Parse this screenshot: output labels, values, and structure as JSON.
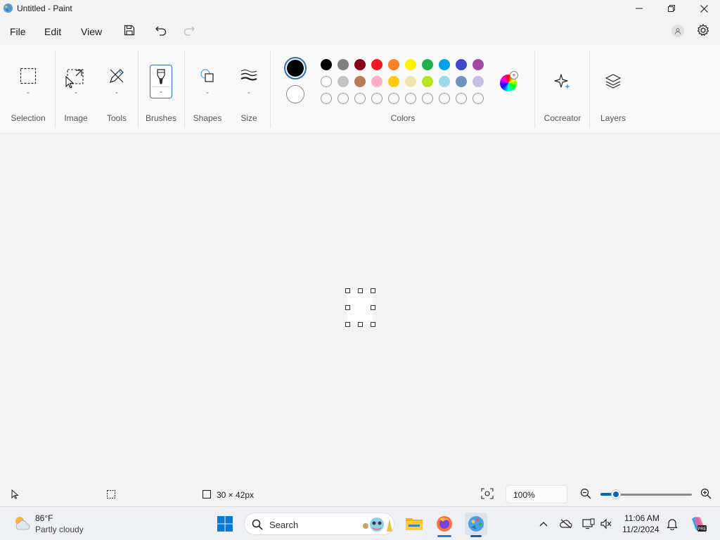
{
  "window": {
    "title": "Untitled - Paint"
  },
  "menu": {
    "file": "File",
    "edit": "Edit",
    "view": "View"
  },
  "ribbon": {
    "selection": "Selection",
    "image": "Image",
    "tools": "Tools",
    "brushes": "Brushes",
    "shapes": "Shapes",
    "size": "Size",
    "colors": "Colors",
    "cocreator": "Cocreator",
    "layers": "Layers"
  },
  "colors": {
    "primary": "#000000",
    "secondary": "#ffffff",
    "row1": [
      "#000000",
      "#7f7f7f",
      "#880015",
      "#ed1c24",
      "#ff7f27",
      "#fff200",
      "#22b14c",
      "#00a2e8",
      "#3f48cc",
      "#a349a4"
    ],
    "row2": [
      "#ffffff",
      "#c3c3c3",
      "#b97a57",
      "#ffaec9",
      "#ffc90e",
      "#efe4b0",
      "#b5e61d",
      "#99d9ea",
      "#7092be",
      "#c8bfe7"
    ],
    "row3_empty_count": 10
  },
  "status": {
    "canvas_size": "30 × 42px",
    "zoom": "100%",
    "zoom_level": 0.17
  },
  "taskbar": {
    "weather_temp": "86°F",
    "weather_desc": "Partly cloudy",
    "search_placeholder": "Search",
    "time": "11:06 AM",
    "date": "11/2/2024"
  }
}
